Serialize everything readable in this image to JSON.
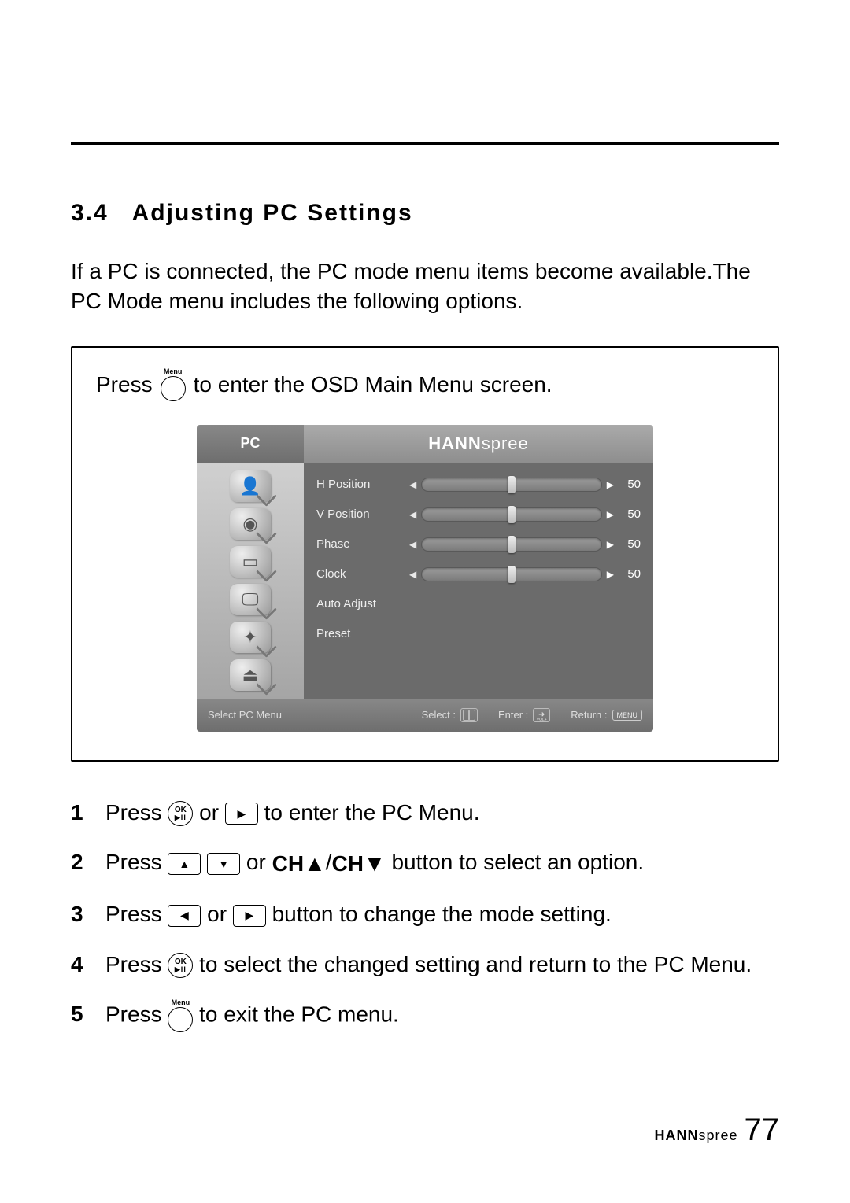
{
  "section": {
    "number": "3.4",
    "title": "Adjusting PC Settings"
  },
  "lead": "If a PC is connected, the PC mode menu items become available.The PC Mode menu includes the following options.",
  "osd_instruction": {
    "pre": "Press",
    "button_label": "Menu",
    "post": "to enter the OSD Main Menu screen."
  },
  "osd": {
    "tab_title": "PC",
    "brand_bold": "HANN",
    "brand_light": "spree",
    "side_icons": [
      "person-icon",
      "eye-icon",
      "monitor-icon",
      "pc-icon",
      "wrench-icon",
      "lock-screen-icon"
    ],
    "rows": [
      {
        "label": "H Position",
        "value": 50,
        "has_slider": true
      },
      {
        "label": "V Position",
        "value": 50,
        "has_slider": true
      },
      {
        "label": "Phase",
        "value": 50,
        "has_slider": true
      },
      {
        "label": "Clock",
        "value": 50,
        "has_slider": true
      },
      {
        "label": "Auto Adjust",
        "value": null,
        "has_slider": false
      },
      {
        "label": "Preset",
        "value": null,
        "has_slider": false
      }
    ],
    "footer": {
      "left": "Select PC Menu",
      "select": "Select :",
      "enter": "Enter :",
      "returnLbl": "Return :",
      "returnBtn": "MENU"
    }
  },
  "steps": [
    {
      "num": "1",
      "parts": [
        "Press ",
        "{OK}",
        " or ",
        "{RIGHT}",
        " to enter the PC Menu."
      ]
    },
    {
      "num": "2",
      "parts": [
        "Press ",
        "{UP}",
        " ",
        "{DOWN}",
        " or ",
        "{BOLD:CH▲}",
        "/",
        "{BOLD:CH▼}",
        " button to select an option."
      ]
    },
    {
      "num": "3",
      "parts": [
        "Press ",
        "{LEFT}",
        " or ",
        "{RIGHT}",
        " button to change the mode setting."
      ]
    },
    {
      "num": "4",
      "parts": [
        "Press ",
        "{OK}",
        " to select the changed setting and return to the PC Menu."
      ]
    },
    {
      "num": "5",
      "parts": [
        "Press ",
        "{MENU}",
        " to exit the PC menu."
      ]
    }
  ],
  "footer": {
    "brand_bold": "HANN",
    "brand_light": "spree",
    "page": "77"
  }
}
